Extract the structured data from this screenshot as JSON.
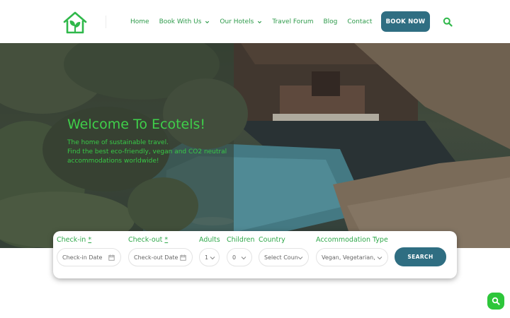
{
  "header": {
    "logo_icon": "eco-house-leaf-icon",
    "nav": [
      {
        "label": "Home",
        "has_dropdown": false
      },
      {
        "label": "Book With Us",
        "has_dropdown": true
      },
      {
        "label": "Our Hotels",
        "has_dropdown": true
      },
      {
        "label": "Travel Forum",
        "has_dropdown": false
      },
      {
        "label": "Blog",
        "has_dropdown": false
      },
      {
        "label": "Contact",
        "has_dropdown": false
      }
    ],
    "book_button": "BOOK NOW",
    "search_icon": "search-icon"
  },
  "hero": {
    "title": "Welcome To Ecotels!",
    "subtitle_lines": [
      "The home of sustainable travel.",
      "Find the best eco-friendly, vegan and CO2 neutral",
      "accommodations worldwide!"
    ]
  },
  "booking": {
    "checkin": {
      "label": "Check-in",
      "required_mark": "*",
      "placeholder": "Check-in Date"
    },
    "checkout": {
      "label": "Check-out",
      "required_mark": "*",
      "placeholder": "Check-out Date"
    },
    "adults": {
      "label": "Adults",
      "value": "1"
    },
    "children": {
      "label": "Children",
      "value": "0"
    },
    "country": {
      "label": "Country",
      "value": "Select Country"
    },
    "accommodation": {
      "label": "Accommodation Type",
      "value": "Vegan, Vegetarian, S"
    },
    "search_button": "SEARCH"
  },
  "colors": {
    "brand_green": "#2d9a4a",
    "hero_green": "#3fcf4a",
    "button_teal": "#2f6e82",
    "fab_green": "#2dc63a"
  }
}
